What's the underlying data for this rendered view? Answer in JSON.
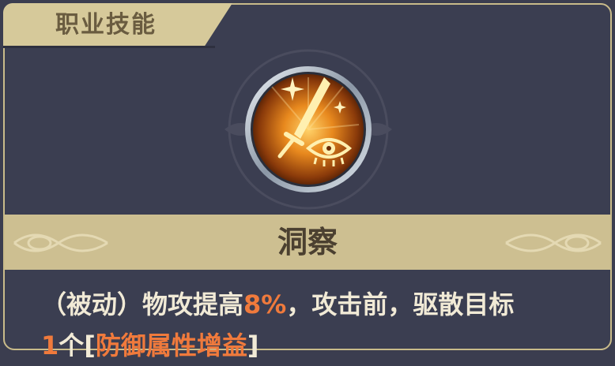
{
  "header": {
    "title": "职业技能"
  },
  "skill": {
    "name": "洞察",
    "desc_part1": "（被动）物攻提高",
    "desc_value": "8%",
    "desc_part2": "，攻击前，驱散目标",
    "desc_line2_count": "1",
    "desc_line2_text": "个",
    "desc_line2_bracket_open": "[",
    "desc_line2_keyword": "防御属性增益",
    "desc_line2_bracket_close": "]"
  },
  "colors": {
    "panel_bg": "#3b3e51",
    "gold_band": "#cdbf91",
    "highlight": "#f07a3c",
    "text_light": "#f1ead6"
  },
  "icons": [
    "sword-icon",
    "eye-icon",
    "sparkle-icon"
  ]
}
